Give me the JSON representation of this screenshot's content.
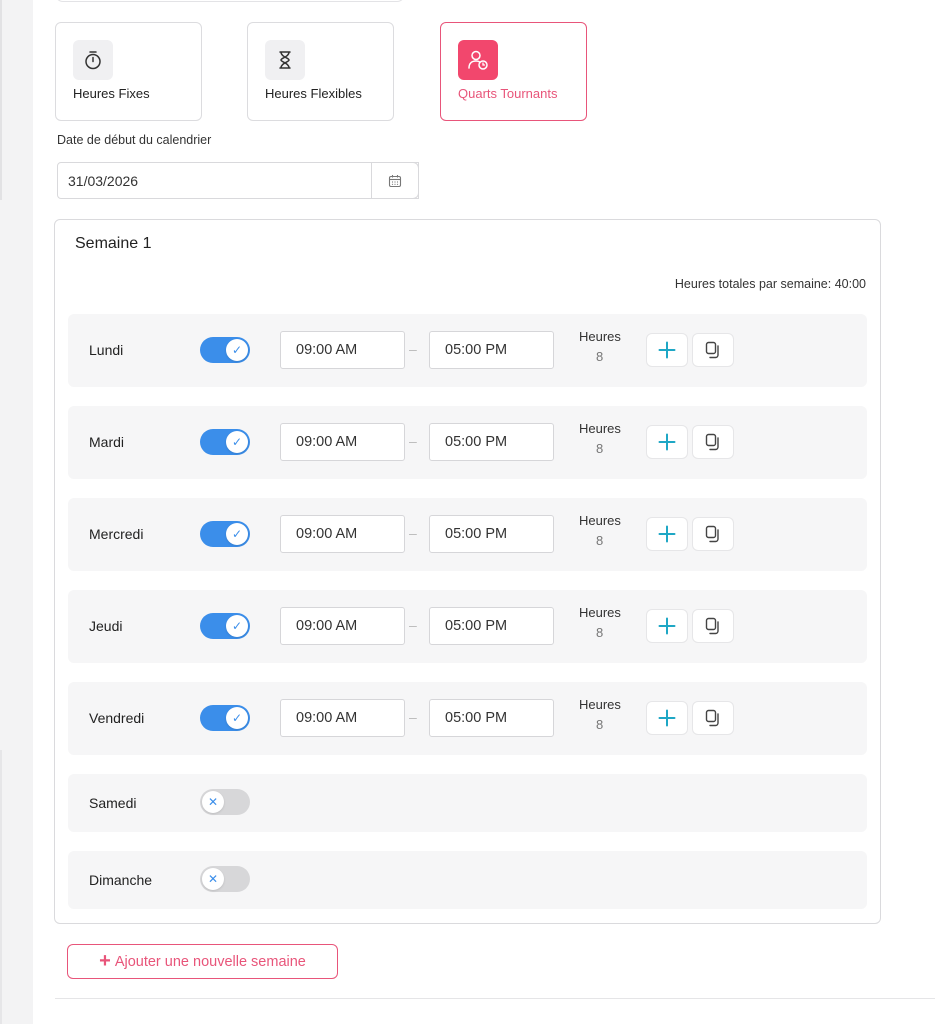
{
  "modes": [
    {
      "label": "Heures Fixes",
      "icon": "stopwatch-icon",
      "active": false
    },
    {
      "label": "Heures Flexibles",
      "icon": "hourglass-icon",
      "active": false
    },
    {
      "label": "Quarts Tournants",
      "icon": "user-clock-icon",
      "active": true
    }
  ],
  "calendar": {
    "start_label": "Date de début du calendrier",
    "start_value": "31/03/2026",
    "picker_icon": "calendar-icon"
  },
  "week": {
    "title": "Semaine 1",
    "total_label": "Heures totales par semaine: 40:00",
    "hours_label": "Heures",
    "days": [
      {
        "name": "Lundi",
        "enabled": true,
        "start": "09:00 AM",
        "end": "05:00 PM",
        "hours": "8"
      },
      {
        "name": "Mardi",
        "enabled": true,
        "start": "09:00 AM",
        "end": "05:00 PM",
        "hours": "8"
      },
      {
        "name": "Mercredi",
        "enabled": true,
        "start": "09:00 AM",
        "end": "05:00 PM",
        "hours": "8"
      },
      {
        "name": "Jeudi",
        "enabled": true,
        "start": "09:00 AM",
        "end": "05:00 PM",
        "hours": "8"
      },
      {
        "name": "Vendredi",
        "enabled": true,
        "start": "09:00 AM",
        "end": "05:00 PM",
        "hours": "8"
      },
      {
        "name": "Samedi",
        "enabled": false
      },
      {
        "name": "Dimanche",
        "enabled": false
      }
    ]
  },
  "add_week_label": "Ajouter une nouvelle semaine",
  "colors": {
    "accent": "#e8557a",
    "accent_fill": "#f2476d",
    "toggle_on": "#3b8eea",
    "toggle_off": "#d7d7d9",
    "plus": "#1ea7c5"
  }
}
